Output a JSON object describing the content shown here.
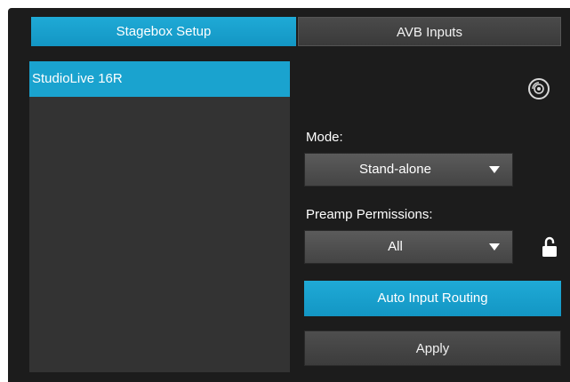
{
  "tabs": {
    "stagebox": "Stagebox Setup",
    "avb": "AVB Inputs"
  },
  "device_list": {
    "items": [
      "StudioLive 16R"
    ],
    "selected": "StudioLive 16R"
  },
  "mode": {
    "label": "Mode:",
    "value": "Stand-alone"
  },
  "preamp": {
    "label": "Preamp Permissions:",
    "value": "All",
    "lock_icon": "unlocked-padlock-icon"
  },
  "buttons": {
    "auto_routing": "Auto Input Routing",
    "apply": "Apply"
  },
  "icons": {
    "refresh": "identify-disc-icon"
  },
  "colors": {
    "accent": "#1AA3CF",
    "panel_bg": "#1C1C1C",
    "list_bg": "#333333",
    "control_bg": "#4A4A4A"
  }
}
